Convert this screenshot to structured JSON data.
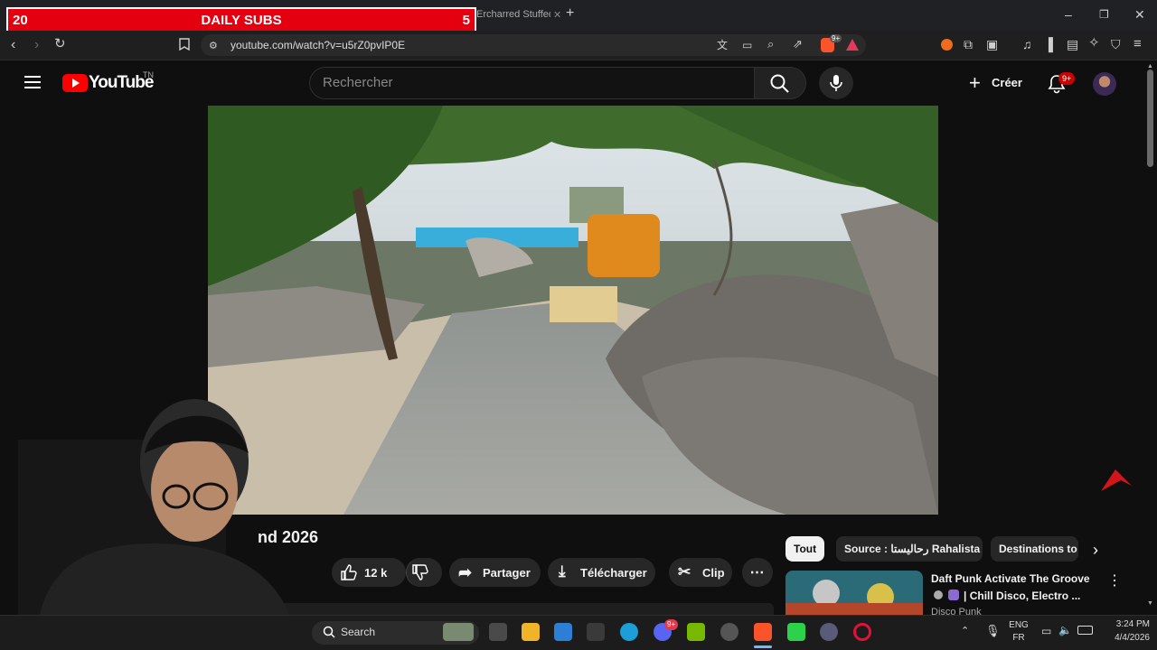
{
  "browser": {
    "tab_title": "Ercharred Stuffed P",
    "url": "youtube.com/watch?v=u5rZ0pvIP0E",
    "new_tab": "+",
    "notif_badge": "9+"
  },
  "overlay": {
    "left_value": "20",
    "label": "DAILY SUBS",
    "right_value": "5"
  },
  "youtube": {
    "logo_text": "YouTube",
    "region": "TN",
    "search_placeholder": "Rechercher",
    "create_label": "Créer",
    "notification_badge": "9+"
  },
  "video": {
    "title_fragment": "nd 2026",
    "like_count": "12 k",
    "share_label": "Partager",
    "download_label": "Télécharger",
    "clip_label": "Clip"
  },
  "chips": [
    "Tout",
    "Source : رحاليستا Rahalista",
    "Destinations to"
  ],
  "recommendation": {
    "title_line1": "Daft Punk Activate The Groove",
    "title_line2": "| Chill Disco, Electro ...",
    "channel": "Disco Punk"
  },
  "taskbar": {
    "search_label": "Search",
    "lang_top": "ENG",
    "lang_bottom": "FR",
    "time": "3:24 PM",
    "date": "4/4/2026",
    "discord_badge": "9+"
  }
}
